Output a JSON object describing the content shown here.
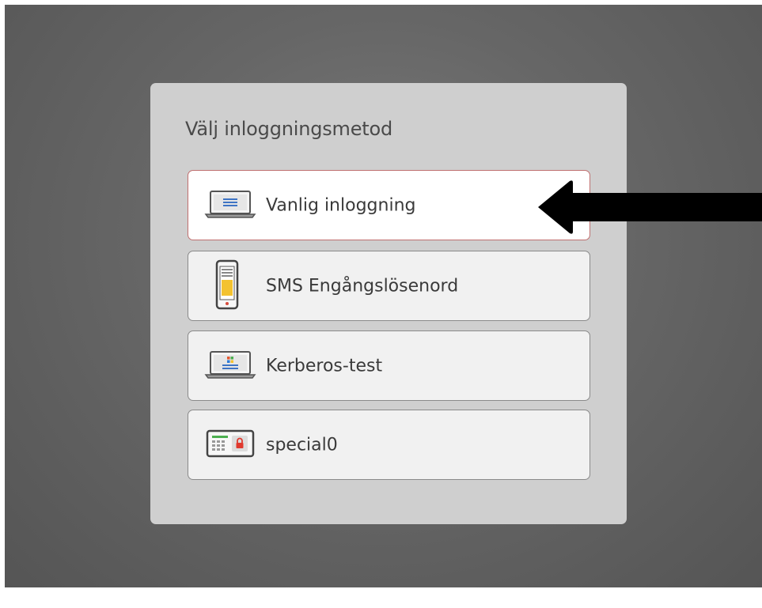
{
  "panel": {
    "title": "Välj inloggningsmetod"
  },
  "methods": [
    {
      "label": "Vanlig inloggning",
      "icon": "laptop-icon",
      "selected": true
    },
    {
      "label": "SMS Engångslösenord",
      "icon": "phone-icon",
      "selected": false
    },
    {
      "label": "Kerberos-test",
      "icon": "laptop-windows-icon",
      "selected": false
    },
    {
      "label": "special0",
      "icon": "keypad-lock-icon",
      "selected": false
    }
  ],
  "annotation": {
    "icon": "arrow-left-icon"
  },
  "colors": {
    "background": "#666666",
    "panel": "#cfcfcf",
    "selected_border": "#c07070",
    "arrow": "#000000"
  }
}
